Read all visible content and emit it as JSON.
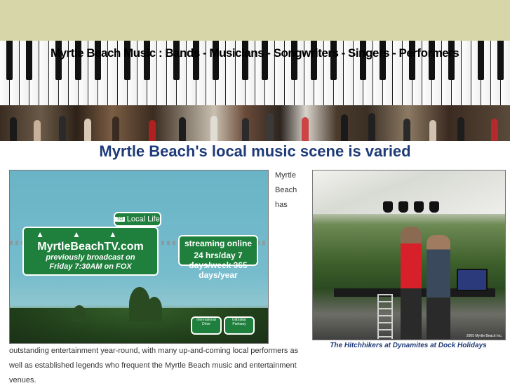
{
  "header": {
    "site_title": "Myrtle Beach Music : Bands - Musicians - Songwriters - Singers - Performers"
  },
  "headline": "Myrtle Beach's local music scene is varied",
  "tv_sign": {
    "to_label": "TO",
    "local_life": "Local Life",
    "site": "MyrtleBeachTV.com",
    "line1": "previously broadcast on",
    "line2": "Friday 7:30AM on FOX",
    "streaming": "streaming online",
    "schedule": "24 hrs/day  7 days/week  365 days/year",
    "small_sign_1": "International Drive",
    "small_sign_2": "Gilbraltar Parkway"
  },
  "intro_text_side": "Myrtle Beach has",
  "intro_text_body": "outstanding entertainment year-round, with many up-and-coming local performers as well as established legends who frequent the Myrtle Beach music and entertainment venues.",
  "band_photo": {
    "caption": "The Hitchhikers at Dynamites at Dock Holidays",
    "credit": "2005 Myrtle Beach Inc."
  },
  "colors": {
    "topbar": "#d7d6a8",
    "headline": "#1e3a78",
    "sign_green": "#1f7f3c"
  }
}
